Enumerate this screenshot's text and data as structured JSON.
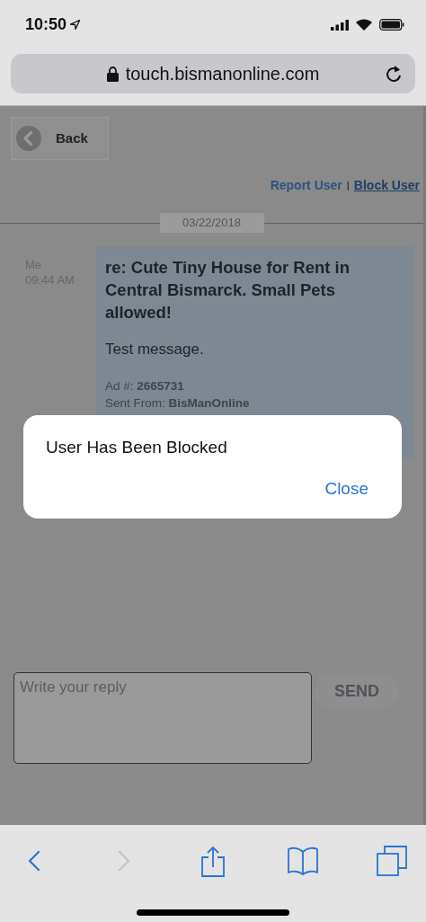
{
  "status_bar": {
    "time": "10:50"
  },
  "address_bar": {
    "url": "touch.bismanonline.com"
  },
  "page": {
    "back_button": "Back",
    "links": [
      {
        "label": "Report User",
        "underlined": false
      },
      {
        "label": "Block User",
        "underlined": true
      }
    ],
    "link_separator": "|",
    "date": "03/22/2018",
    "message": {
      "sender": "Me",
      "time": "09:44 AM",
      "subject": "re: Cute Tiny House for Rent in Central Bismarck. Small Pets allowed!",
      "body": "Test message.",
      "ad_label": "Ad #:",
      "ad_number": "2665731",
      "source_label": "Sent From:",
      "source": "BisManOnline"
    },
    "reply": {
      "placeholder": "Write your reply"
    },
    "send_button": "SEND"
  },
  "alert": {
    "message": "User Has Been Blocked",
    "button": "Close"
  },
  "toolbar": [
    {
      "kind": "back",
      "disabled": false
    },
    {
      "kind": "forward",
      "disabled": true
    },
    {
      "kind": "share",
      "disabled": false
    },
    {
      "kind": "bookmarks",
      "disabled": false
    },
    {
      "kind": "tabs",
      "disabled": false
    }
  ]
}
